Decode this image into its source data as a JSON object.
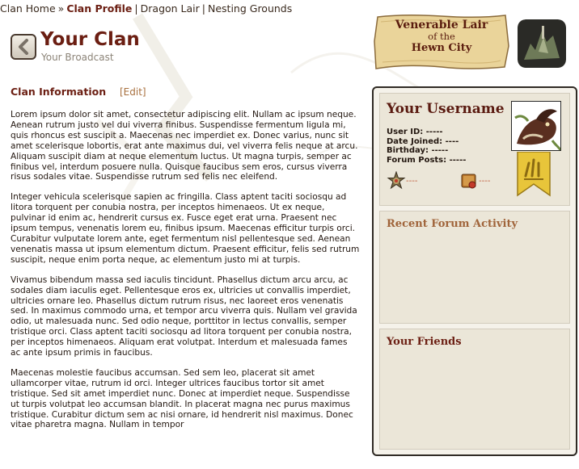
{
  "breadcrumb": {
    "items": [
      "Clan Home",
      "Clan Profile",
      "Dragon Lair",
      "Nesting Grounds"
    ],
    "separators": [
      "»",
      "|",
      "|"
    ]
  },
  "header": {
    "title": "Your Clan",
    "subtitle": "Your Broadcast"
  },
  "lair": {
    "line1": "Venerable Lair",
    "line2": "of the",
    "line3": "Hewn City"
  },
  "clan_info": {
    "heading": "Clan Information",
    "edit_label": "[Edit]",
    "paragraphs": [
      "Lorem ipsum dolor sit amet, consectetur adipiscing elit. Nullam ac ipsum neque. Aenean rutrum justo vel dui viverra finibus. Suspendisse fermentum ligula mi, quis rhoncus est suscipit a. Maecenas nec imperdiet ex. Donec varius, nunc sit amet scelerisque lobortis, erat ante maximus dui, vel viverra felis neque at arcu. Aliquam suscipit diam at neque elementum luctus. Ut magna turpis, semper ac finibus vel, interdum posuere nulla. Quisque faucibus sem eros, cursus viverra risus sodales vitae. Suspendisse rutrum sed felis nec eleifend.",
      "Integer vehicula scelerisque sapien ac fringilla. Class aptent taciti sociosqu ad litora torquent per conubia nostra, per inceptos himenaeos. Ut ex neque, pulvinar id enim ac, hendrerit cursus ex. Fusce eget erat urna. Praesent nec ipsum tempus, venenatis lorem eu, finibus ipsum. Maecenas efficitur turpis orci. Curabitur vulputate lorem ante, eget fermentum nisl pellentesque sed. Aenean venenatis massa ut ipsum elementum dictum. Praesent efficitur, felis sed rutrum suscipit, neque enim porta neque, ac elementum justo mi at turpis.",
      "Vivamus bibendum massa sed iaculis tincidunt. Phasellus dictum arcu arcu, ac sodales diam iaculis eget. Pellentesque eros ex, ultricies ut convallis imperdiet, ultricies ornare leo. Phasellus dictum rutrum risus, nec laoreet eros venenatis sed. In maximus commodo urna, et tempor arcu viverra quis. Nullam vel gravida odio, ut malesuada nunc. Sed odio neque, porttitor in lectus convallis, semper tristique orci. Class aptent taciti sociosqu ad litora torquent per conubia nostra, per inceptos himenaeos. Aliquam erat volutpat. Interdum et malesuada fames ac ante ipsum primis in faucibus.",
      "Maecenas molestie faucibus accumsan. Sed sem leo, placerat sit amet ullamcorper vitae, rutrum id orci. Integer ultrices faucibus tortor sit amet tristique. Sed sit amet imperdiet nunc. Donec at imperdiet neque. Suspendisse ut turpis volutpat leo accumsan blandit. In placerat magna nec purus maximus tristique. Curabitur dictum sem ac nisi ornare, id hendrerit nisl maximus. Donec vitae pharetra magna. Nullam in tempor"
    ]
  },
  "profile": {
    "username": "Your Username",
    "user_id_label": "User ID:",
    "user_id_value": "-----",
    "date_joined_label": "Date Joined:",
    "date_joined_value": "----",
    "birthday_label": "Birthday:",
    "birthday_value": "-----",
    "forum_posts_label": "Forum Posts:",
    "forum_posts_value": "-----",
    "badge1_value": "----",
    "badge2_value": "----"
  },
  "recent_activity": {
    "heading": "Recent Forum Activity"
  },
  "friends": {
    "heading": "Your Friends"
  },
  "colors": {
    "title": "#6b1e12",
    "edit_link": "#a8703e",
    "activity_heading": "#a0643a",
    "panel_bg": "#ebe6d8",
    "ribbon": "#e8c53a"
  }
}
